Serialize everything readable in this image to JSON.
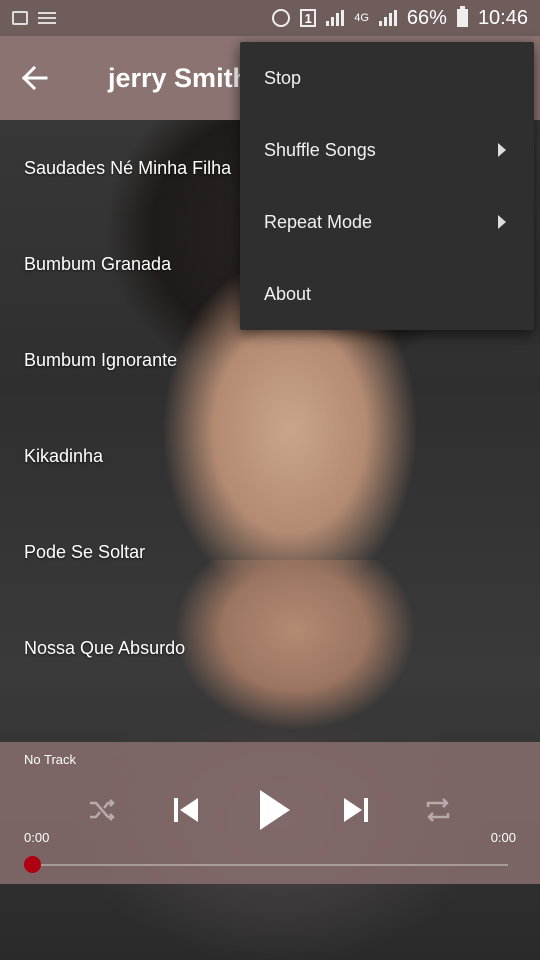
{
  "status_bar": {
    "battery": "66%",
    "time": "10:46",
    "network": "4G",
    "sim": "1"
  },
  "app_bar": {
    "title": "jerry Smith"
  },
  "songs": [
    "Saudades Né Minha Filha",
    "Bumbum Granada",
    "Bumbum Ignorante",
    "Kikadinha",
    "Pode Se Soltar",
    "Nossa Que Absurdo"
  ],
  "menu": {
    "items": [
      {
        "label": "Stop",
        "submenu": false
      },
      {
        "label": "Shuffle Songs",
        "submenu": true
      },
      {
        "label": "Repeat Mode",
        "submenu": true
      },
      {
        "label": "About",
        "submenu": false
      }
    ]
  },
  "player": {
    "track": "No Track",
    "elapsed": "0:00",
    "duration": "0:00",
    "progress": 0,
    "accent_color": "#b00014"
  },
  "icons": [
    "image-icon",
    "list-icon",
    "alarm-icon",
    "sim-icon",
    "signal-icon",
    "battery-icon",
    "back-arrow-icon",
    "shuffle-icon",
    "previous-icon",
    "play-icon",
    "next-icon",
    "repeat-icon",
    "submenu-arrow-icon"
  ]
}
